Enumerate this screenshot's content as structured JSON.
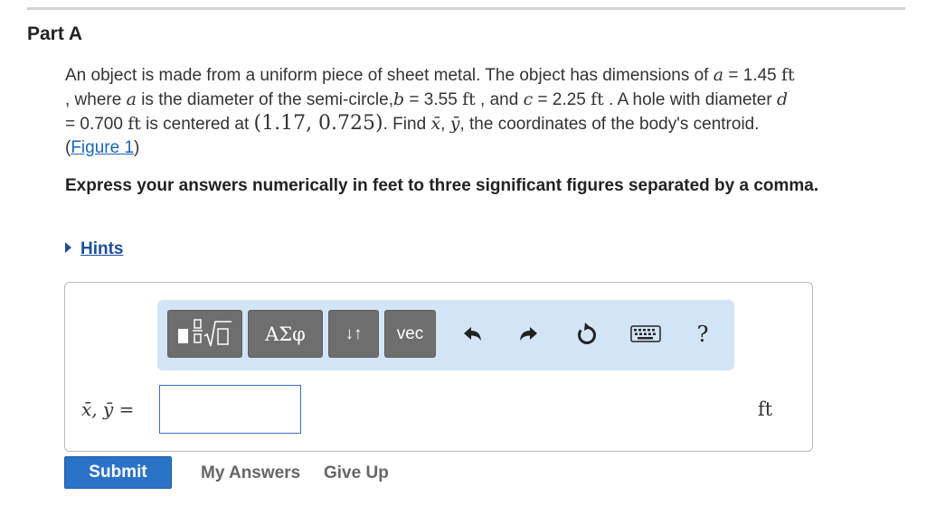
{
  "part": {
    "title": "Part A"
  },
  "problem": {
    "t1": "An object is made from a uniform piece of sheet metal. The object has dimensions of ",
    "var_a": "a",
    "eq_a": " = 1.45 ",
    "unit_ft": "ft",
    "t2": ", where ",
    "t3": " is the diameter of the semi-circle,",
    "var_b": "b",
    "eq_b": " = 3.55 ",
    "t4": " , and ",
    "var_c": "c",
    "eq_c": " = 2.25 ",
    "t5": " . A hole with diameter ",
    "var_d": "d",
    "eq_d": " = 0.700 ",
    "t6": " is centered at ",
    "point": "(1.17, 0.725)",
    "t7": ". Find ",
    "xbar": "x̄",
    "comma": ", ",
    "ybar": "ȳ",
    "t8": ", the coordinates of the body's centroid.",
    "paren_open": "(",
    "figure_link": "Figure 1",
    "paren_close": ")"
  },
  "instructions": "Express your answers numerically in feet to three significant figures separated by a comma.",
  "hints": {
    "label": "Hints",
    "icon": "caret-right-icon"
  },
  "toolbar": {
    "templates_icon": "fraction-sqrt-template-icon",
    "greek_label": "ΑΣφ",
    "arrows_label": "↓↑",
    "vec_label": "vec",
    "help_label": "?",
    "colors": {
      "panel": "#d3e4f6",
      "button": "#6e6e6e"
    }
  },
  "answer": {
    "label": "x̄, ȳ =",
    "value": "",
    "unit": "ft"
  },
  "actions": {
    "submit": "Submit",
    "my_answers": "My Answers",
    "give_up": "Give Up"
  },
  "colors": {
    "submit": "#2b73c7",
    "link": "#1a64b5",
    "hints": "#1a4f9c"
  }
}
